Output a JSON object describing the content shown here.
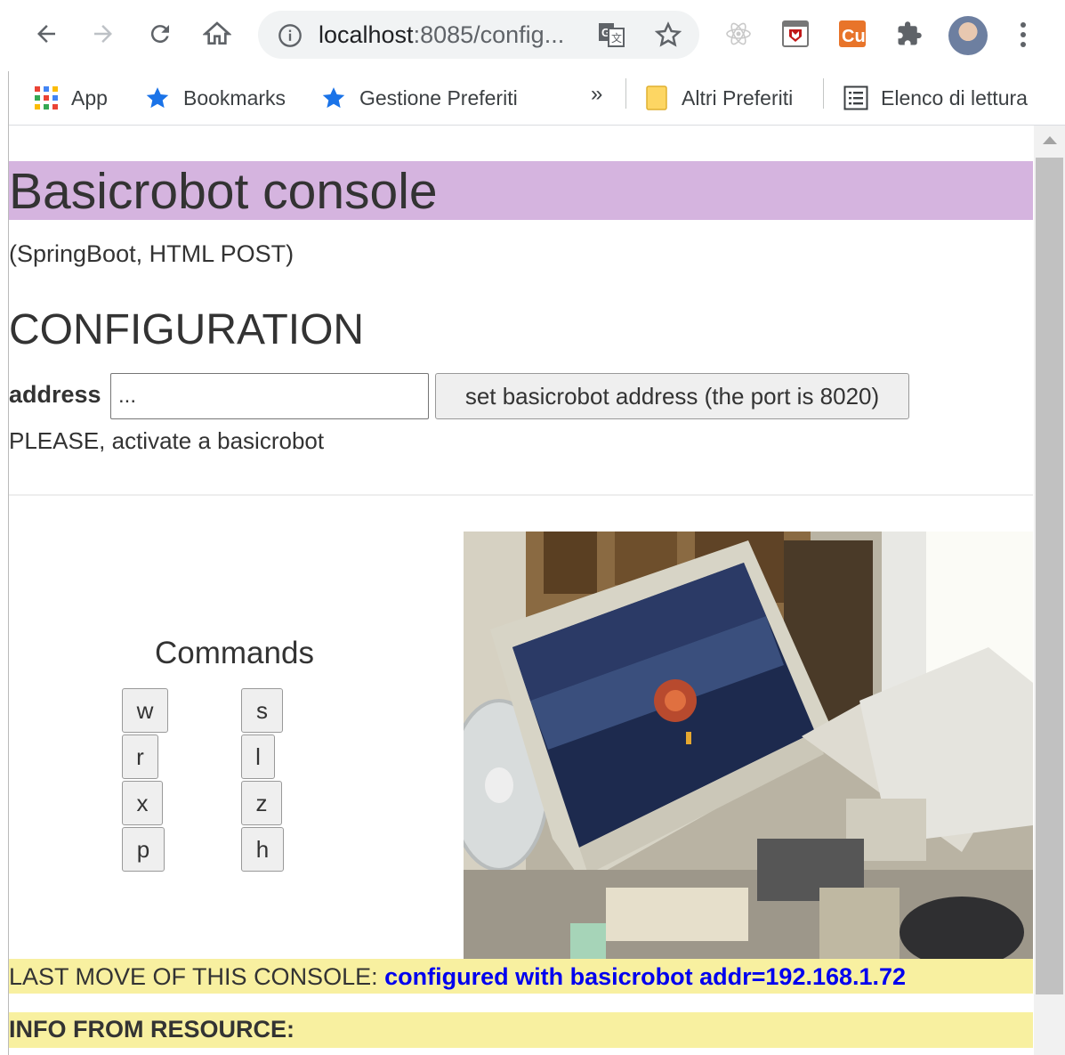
{
  "browser": {
    "url_host": "localhost",
    "url_rest": ":8085/config...",
    "bookmarks": [
      {
        "label": "App",
        "icon": "apps-grid-icon"
      },
      {
        "label": "Bookmarks",
        "icon": "star-icon"
      },
      {
        "label": "Gestione Preferiti",
        "icon": "star-icon"
      }
    ],
    "more_label": "»",
    "other_bookmarks": "Altri Preferiti",
    "reading_list": "Elenco di lettura"
  },
  "page": {
    "title": "Basicrobot console",
    "subtitle": "(SpringBoot, HTML POST)",
    "config_heading": "CONFIGURATION",
    "address_label": "address",
    "address_value": "...",
    "set_button": "set basicrobot address (the port is 8020)",
    "please_msg": "PLEASE, activate a basicrobot",
    "commands_heading": "Commands",
    "commands": [
      "w",
      "r",
      "x",
      "p",
      "s",
      "l",
      "z",
      "h"
    ],
    "last_move_label": "LAST MOVE OF THIS CONSOLE:",
    "last_move_value": "configured with basicrobot addr=192.168.1.72",
    "info_label": "INFO FROM RESOURCE:"
  },
  "colors": {
    "title_bg": "#d5b4df",
    "status_bg": "#f8f0a0",
    "link_blue": "#0000ee"
  }
}
